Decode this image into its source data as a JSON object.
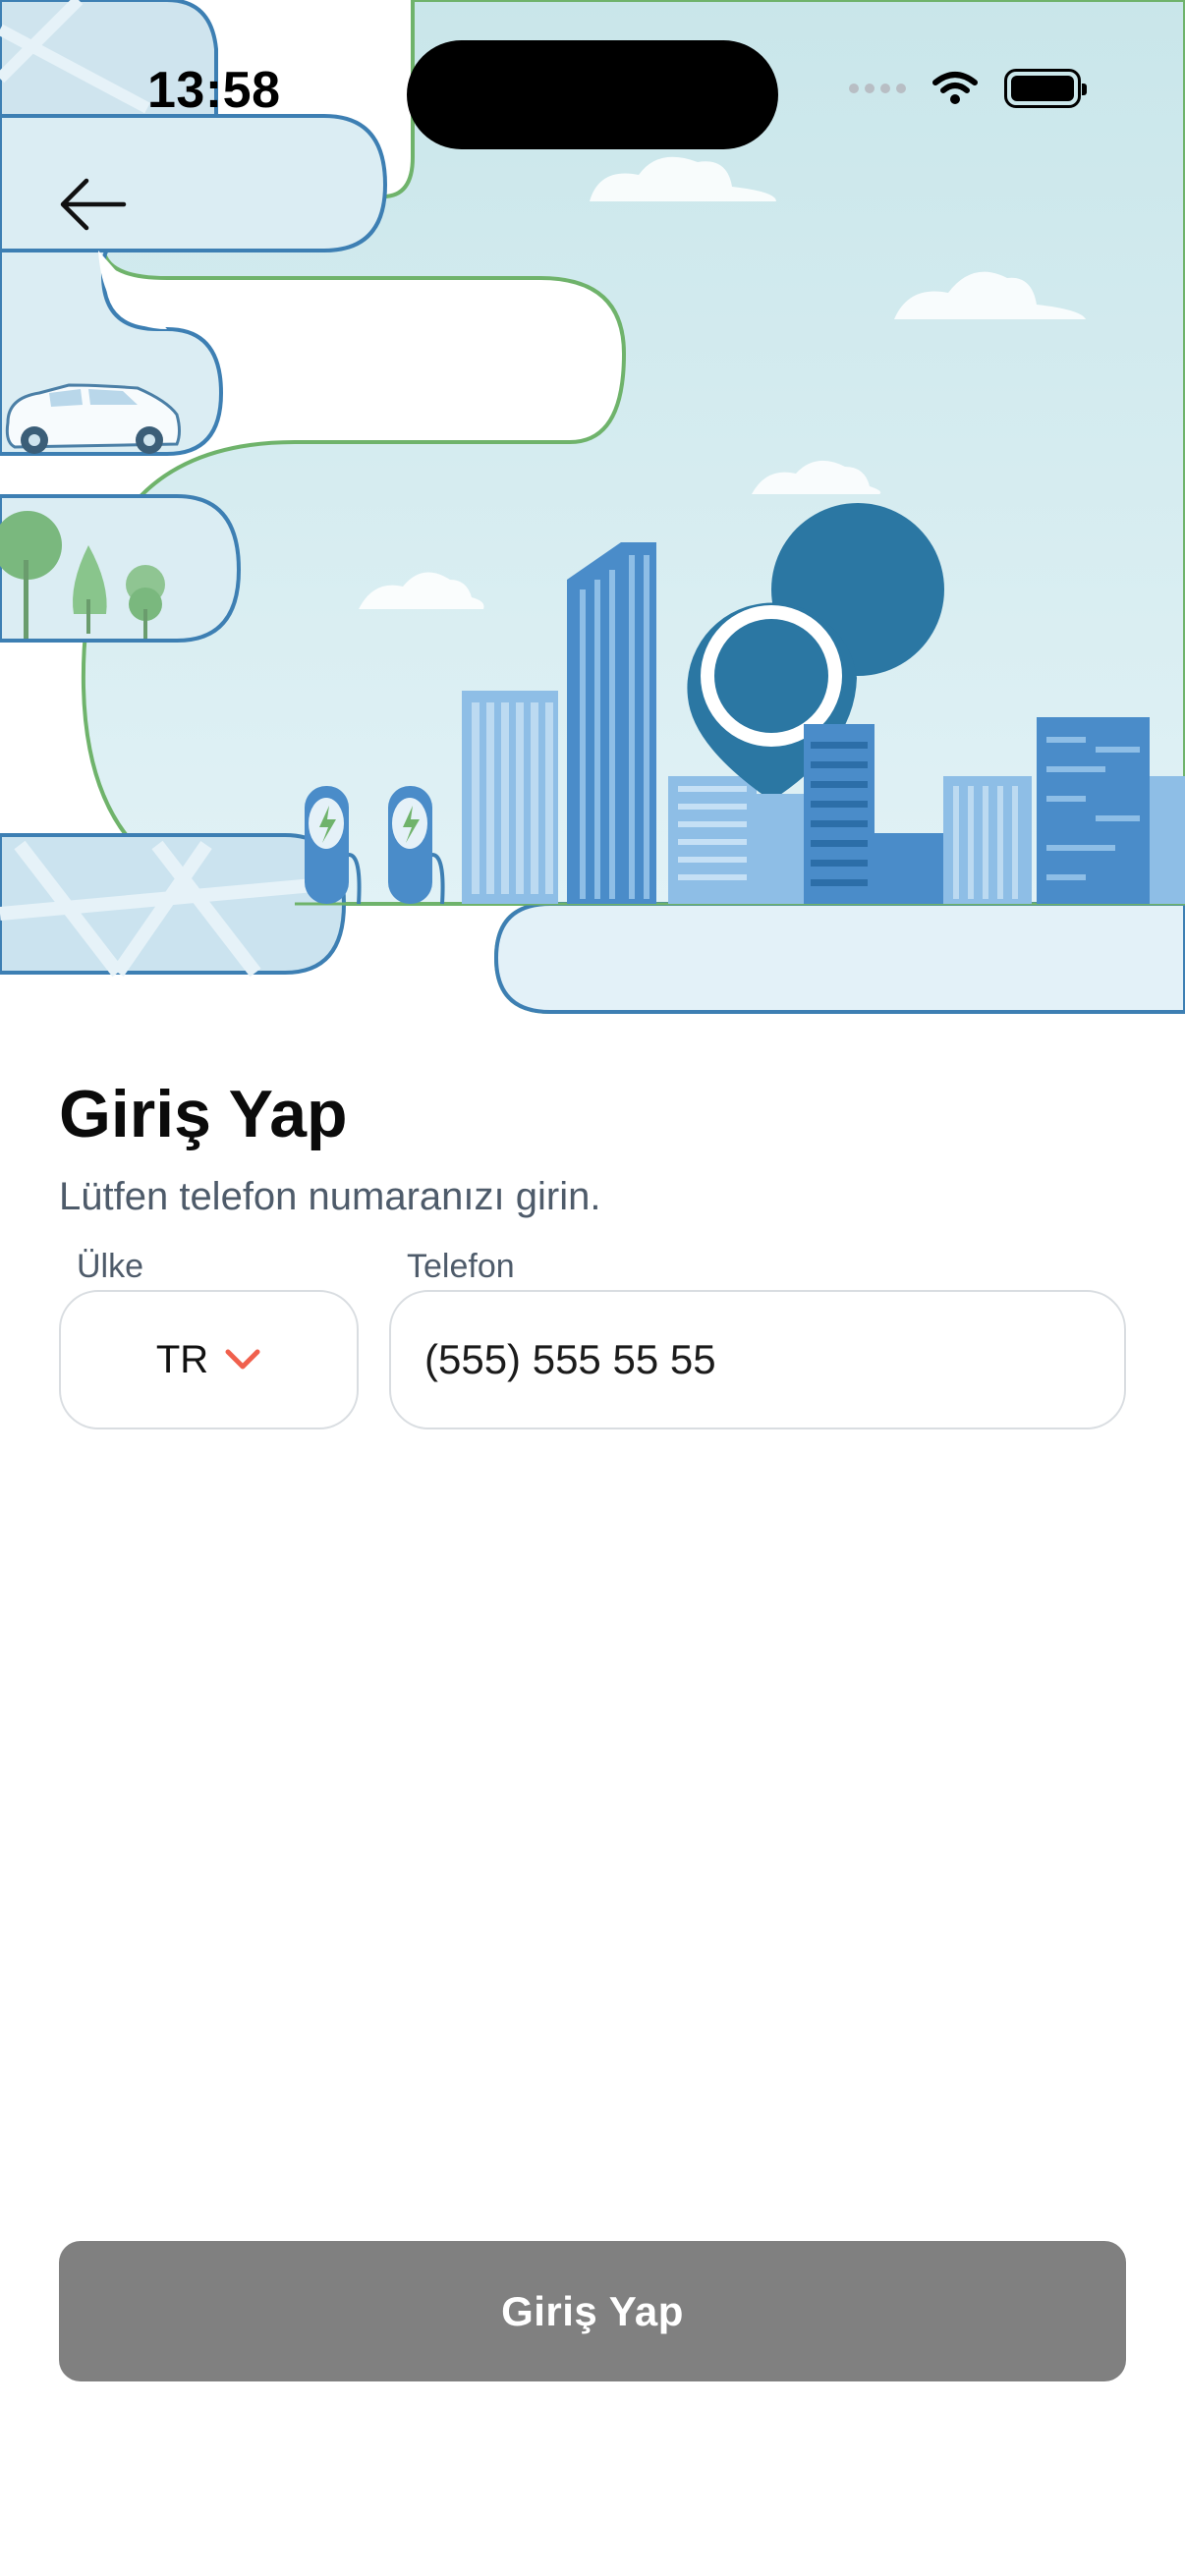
{
  "status_bar": {
    "time": "13:58",
    "icons": [
      "signal-dots-icon",
      "wifi-icon",
      "battery-icon"
    ]
  },
  "header": {
    "back_icon": "arrow-left-icon"
  },
  "hero": {
    "illustration": "city-ev-charging-illustration",
    "colors": {
      "sky": "#d8eef2",
      "building_blue": "#4a8cc9",
      "pin": "#2b77a3",
      "outline_green": "#6fb36b",
      "outline_blue": "#3d7fb3"
    }
  },
  "form": {
    "title": "Giriş Yap",
    "subtitle": "Lütfen telefon numaranızı girin.",
    "country_label": "Ülke",
    "country_value": "TR",
    "phone_label": "Telefon",
    "phone_placeholder": "(555) 555 55 55"
  },
  "actions": {
    "login_label": "Giriş Yap",
    "login_color": "#808080"
  }
}
